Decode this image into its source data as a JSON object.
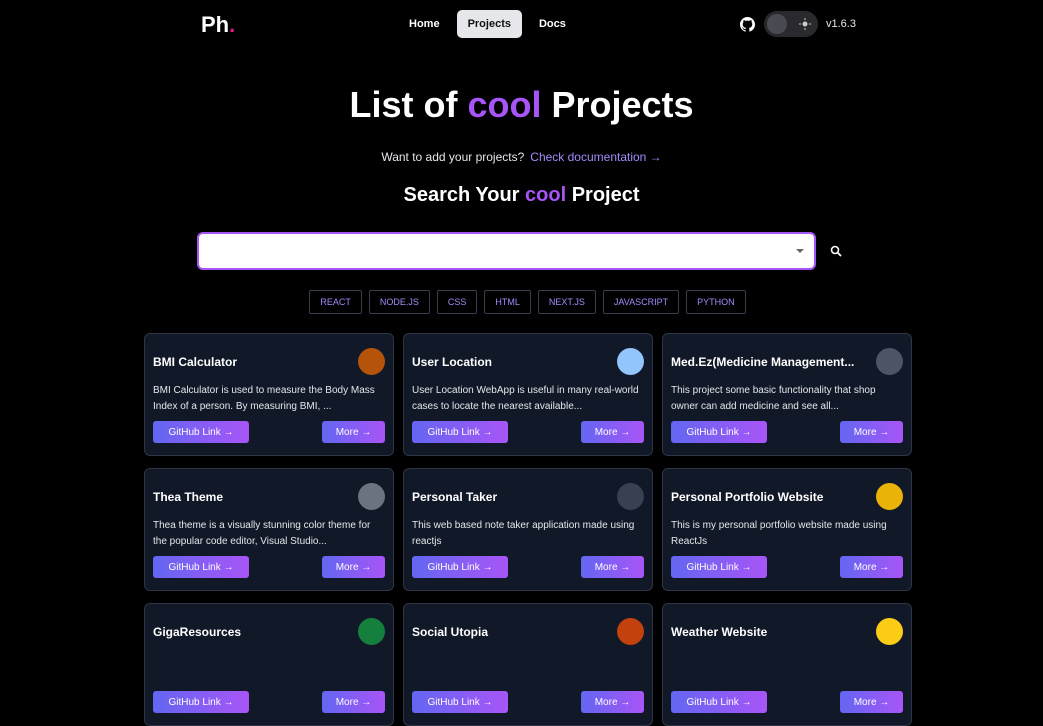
{
  "nav": {
    "logo_text": "Ph",
    "logo_dot": ".",
    "links": [
      {
        "label": "Home"
      },
      {
        "label": "Projects"
      },
      {
        "label": "Docs"
      }
    ],
    "version": "v1.6.3"
  },
  "hero": {
    "title_pre": "List of ",
    "title_cool": "cool",
    "title_post": " Projects",
    "subtitle": "Want to add your projects?",
    "doc_link": "Check documentation →"
  },
  "search": {
    "title_pre": "Search Your ",
    "title_cool": "cool",
    "title_post": " Project",
    "value": ""
  },
  "tags": [
    "REACT",
    "NODE.JS",
    "CSS",
    "HTML",
    "NEXT.JS",
    "JAVASCRIPT",
    "PYTHON"
  ],
  "colors": {
    "accent": "#a855f7",
    "card_bg": "#111827",
    "brand_dot": "#e11d74"
  },
  "projects": [
    {
      "title": "BMI Calculator",
      "desc": "BMI Calculator is used to measure the Body Mass Index of a person. By measuring BMI, ...",
      "github": "GitHub Link →",
      "more": "More →",
      "avatar": "#b45309"
    },
    {
      "title": "User Location",
      "desc": "User Location WebApp is useful in many real-world cases to locate the nearest available...",
      "github": "GitHub Link →",
      "more": "More →",
      "avatar": "#93c5fd"
    },
    {
      "title": "Med.Ez(Medicine Management...",
      "desc": "This project some basic functionality that shop owner can add medicine and see all...",
      "github": "GitHub Link →",
      "more": "More →",
      "avatar": "#4b5563"
    },
    {
      "title": "Thea Theme",
      "desc": "Thea theme is a visually stunning color theme for the popular code editor, Visual Studio...",
      "github": "GitHub Link →",
      "more": "More →",
      "avatar": "#6b7280"
    },
    {
      "title": "Personal Taker",
      "desc": "This web based note taker application made using reactjs",
      "github": "GitHub Link →",
      "more": "More →",
      "avatar": "#374151"
    },
    {
      "title": "Personal Portfolio Website",
      "desc": "This is my personal portfolio website made using ReactJs",
      "github": "GitHub Link →",
      "more": "More →",
      "avatar": "#eab308"
    },
    {
      "title": "GigaResources",
      "desc": "",
      "github": "GitHub Link →",
      "more": "More →",
      "avatar": "#15803d"
    },
    {
      "title": "Social Utopia",
      "desc": "",
      "github": "GitHub Link →",
      "more": "More →",
      "avatar": "#c2410c"
    },
    {
      "title": "Weather Website",
      "desc": "",
      "github": "GitHub Link →",
      "more": "More →",
      "avatar": "#facc15"
    }
  ]
}
